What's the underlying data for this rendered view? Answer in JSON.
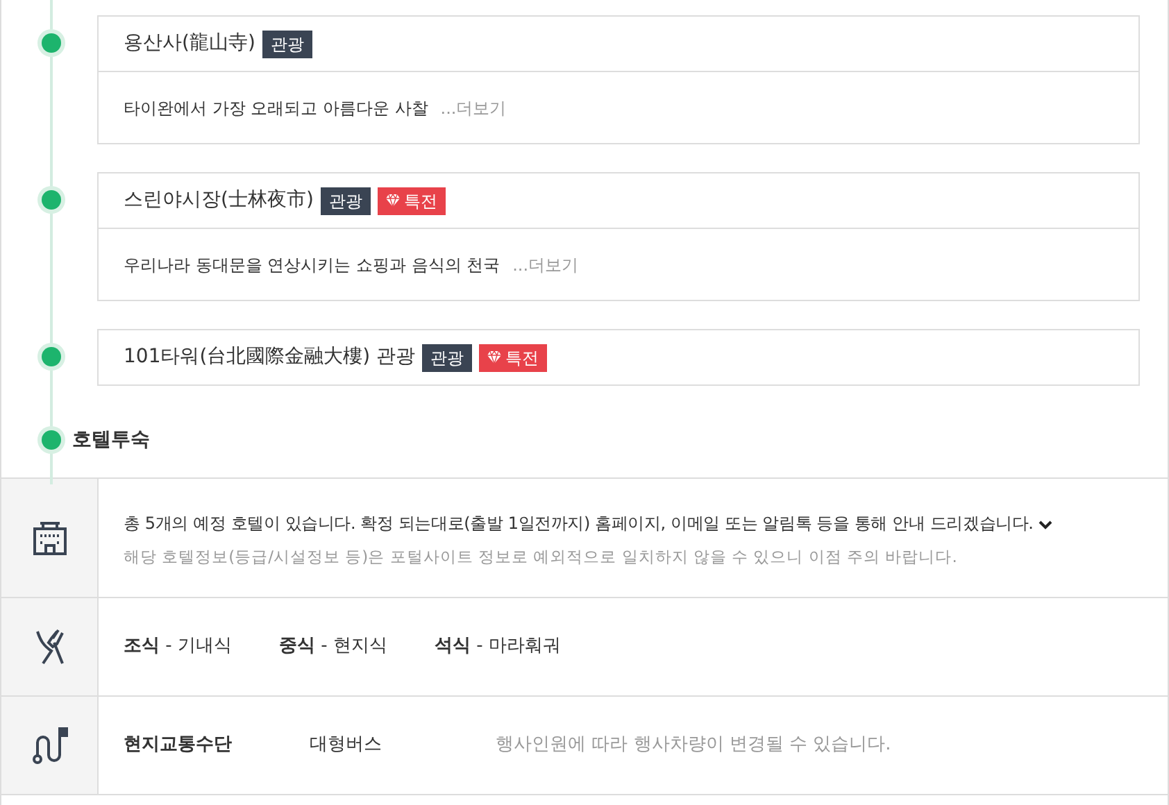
{
  "schedule": [
    {
      "title": "용산사(龍山寺)",
      "tags": [
        {
          "kind": "category",
          "label": "관광"
        }
      ],
      "description": "타이완에서 가장 오래되고 아름다운 사찰",
      "more": "...더보기"
    },
    {
      "title": "스린야시장(士林夜市)",
      "tags": [
        {
          "kind": "category",
          "label": "관광"
        },
        {
          "kind": "special",
          "label": "특전"
        }
      ],
      "description": "우리나라 동대문을 연상시키는 쇼핑과 음식의 천국",
      "more": "...더보기"
    },
    {
      "title": "101타워(台北國際金融大樓) 관광",
      "tags": [
        {
          "kind": "category",
          "label": "관광"
        },
        {
          "kind": "special",
          "label": "특전"
        }
      ]
    }
  ],
  "stay": {
    "title": "호텔투숙"
  },
  "info": [
    {
      "kind": "hotel",
      "text": "총 5개의 예정 호텔이 있습니다. 확정 되는대로(출발 1일전까지) 홈페이지, 이메일 또는 알림톡 등을 통해 안내 드리겠습니다.",
      "note": "해당 호텔정보(등급/시설정보 등)은 포털사이트 정보로 예외적으로 일치하지 않을 수 있으니 이점 주의 바랍니다.",
      "expanded": false
    },
    {
      "kind": "meals",
      "meals": [
        "**조식** - 기내식",
        "**중식** - 현지식",
        "**석식** - 마라훠궈"
      ]
    },
    {
      "kind": "transport",
      "label": "현지교통수단",
      "value": "대형버스",
      "note": "행사인원에 따라 행사차량이 변경될 수 있습니다."
    }
  ]
}
